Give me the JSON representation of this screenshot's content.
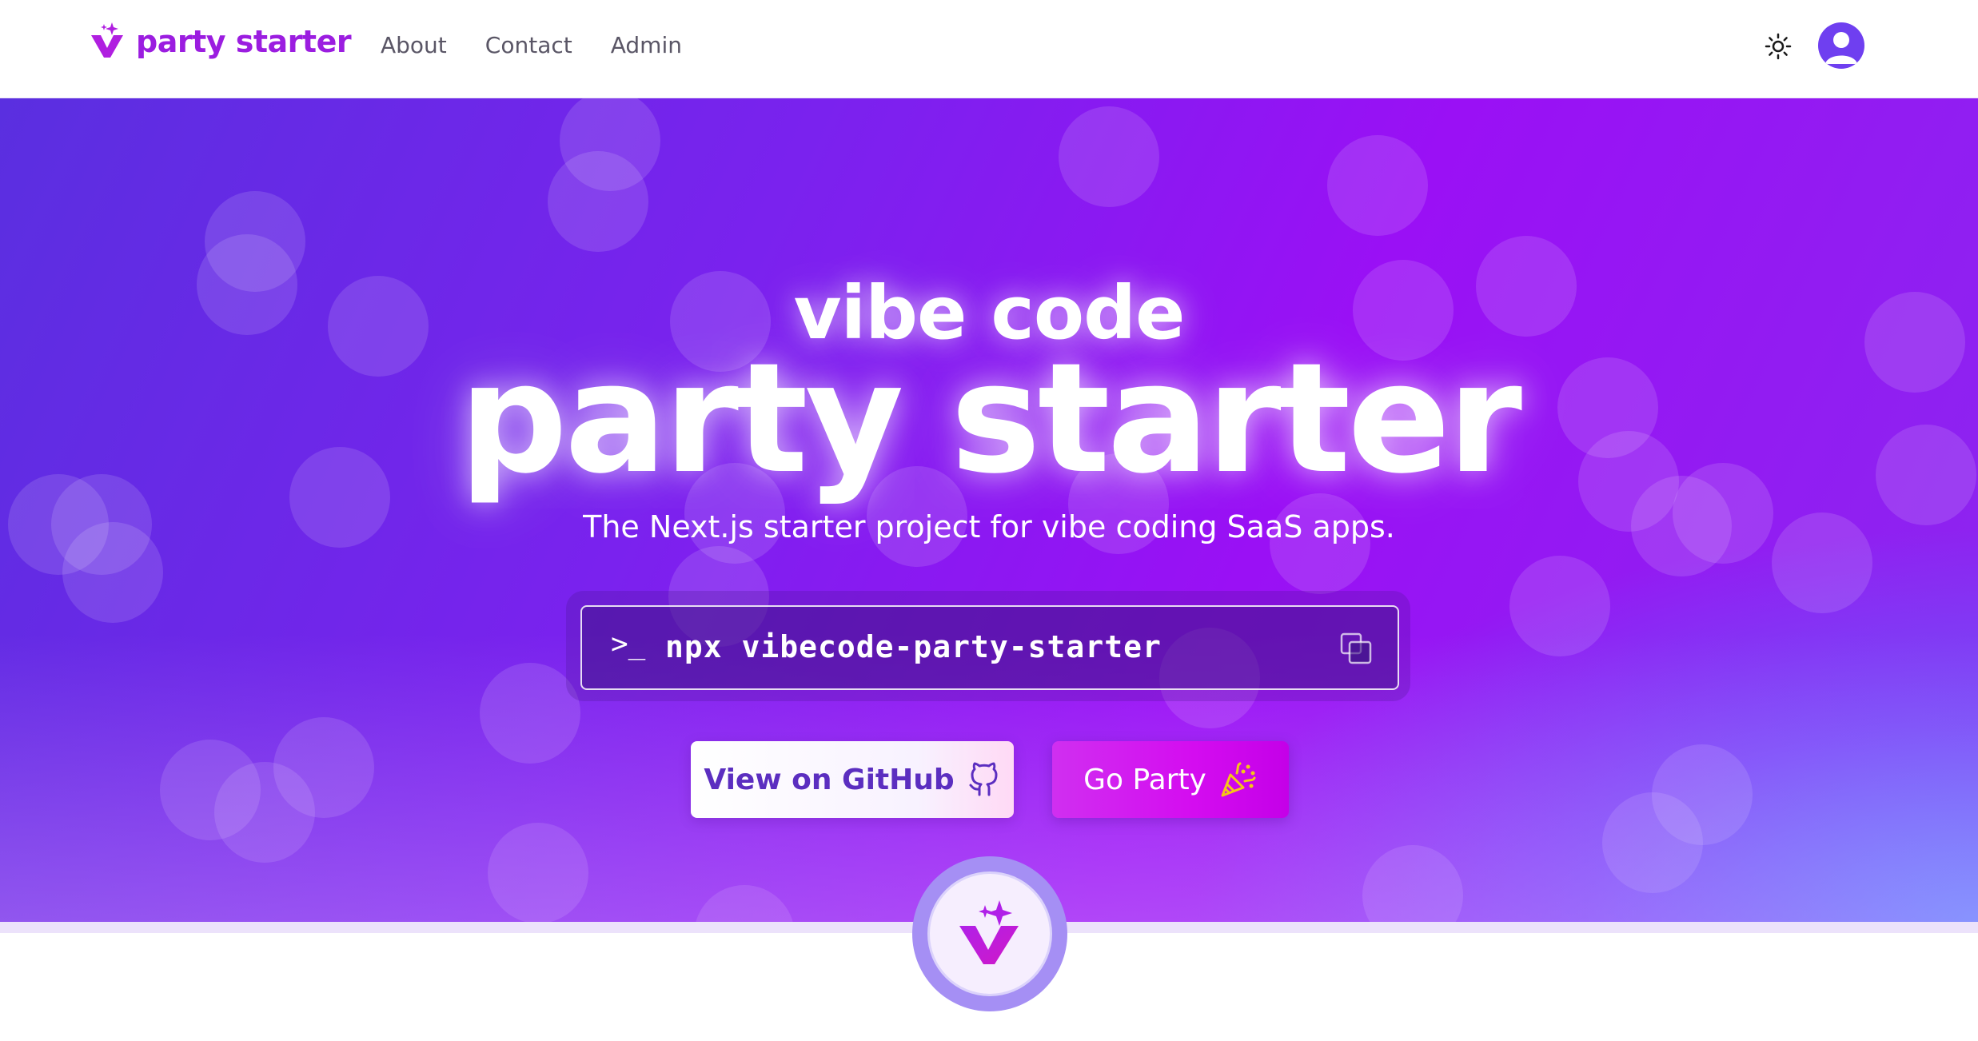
{
  "header": {
    "brand": "party starter",
    "nav": [
      "About",
      "Contact",
      "Admin"
    ]
  },
  "hero": {
    "title_small": "vibe code",
    "title_big": "party starter",
    "subtitle": "The Next.js starter project for vibe coding SaaS apps.",
    "command_prompt": ">_",
    "command": "npx vibecode-party-starter",
    "github_button": "View on GitHub",
    "party_button": "Go Party"
  },
  "colors": {
    "brand": "#9b1de0",
    "hero_start": "#5a2fe0",
    "hero_mid": "#9a10f5",
    "hero_end": "#598cff",
    "party_button": "#d40cf0",
    "github_button_text": "#5b2ec0"
  },
  "icons": [
    "sparkle-v-logo-icon",
    "sun-icon",
    "user-avatar-icon",
    "terminal-prompt-icon",
    "copy-icon",
    "github-icon",
    "party-popper-icon"
  ]
}
